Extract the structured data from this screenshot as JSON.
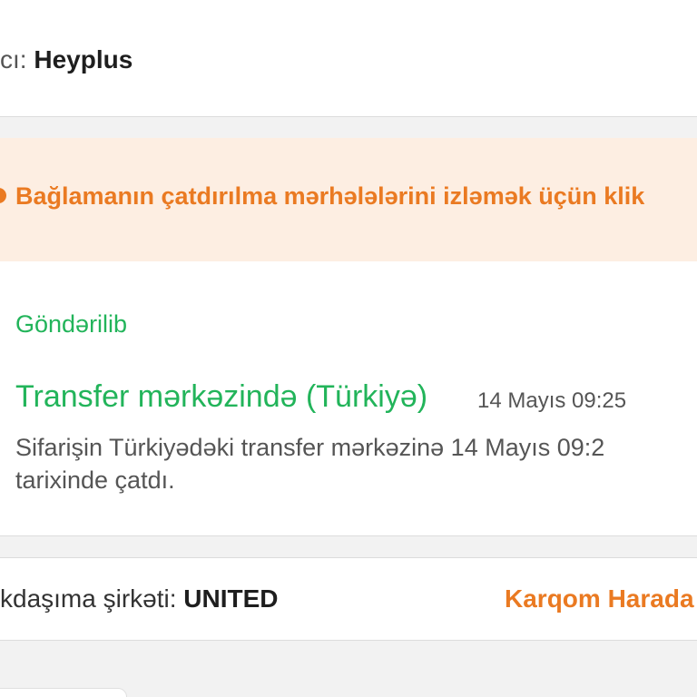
{
  "seller": {
    "label": "cı:",
    "value": "Heyplus"
  },
  "tracking_banner": {
    "icon": "info-circle-icon",
    "text": "Bağlamanın çatdırılma mərhələlərini izləmək üçün klik"
  },
  "status": {
    "heading": "Göndərilib",
    "event_title": "Transfer mərkəzində (Türkiyə)",
    "event_time": "14 Mayıs 09:25",
    "event_description_line1": "Sifarişin Türkiyədəki transfer mərkəzinə 14 Mayıs 09:2",
    "event_description_line2": "tarixinde çatdı."
  },
  "carrier": {
    "label": "kdaşıma şirkəti:",
    "value": "UNITED",
    "link_text": "Karqom Harada"
  },
  "colors": {
    "accent_orange": "#ea7a22",
    "banner_bg": "#fdeee2",
    "status_green": "#22b45a"
  }
}
